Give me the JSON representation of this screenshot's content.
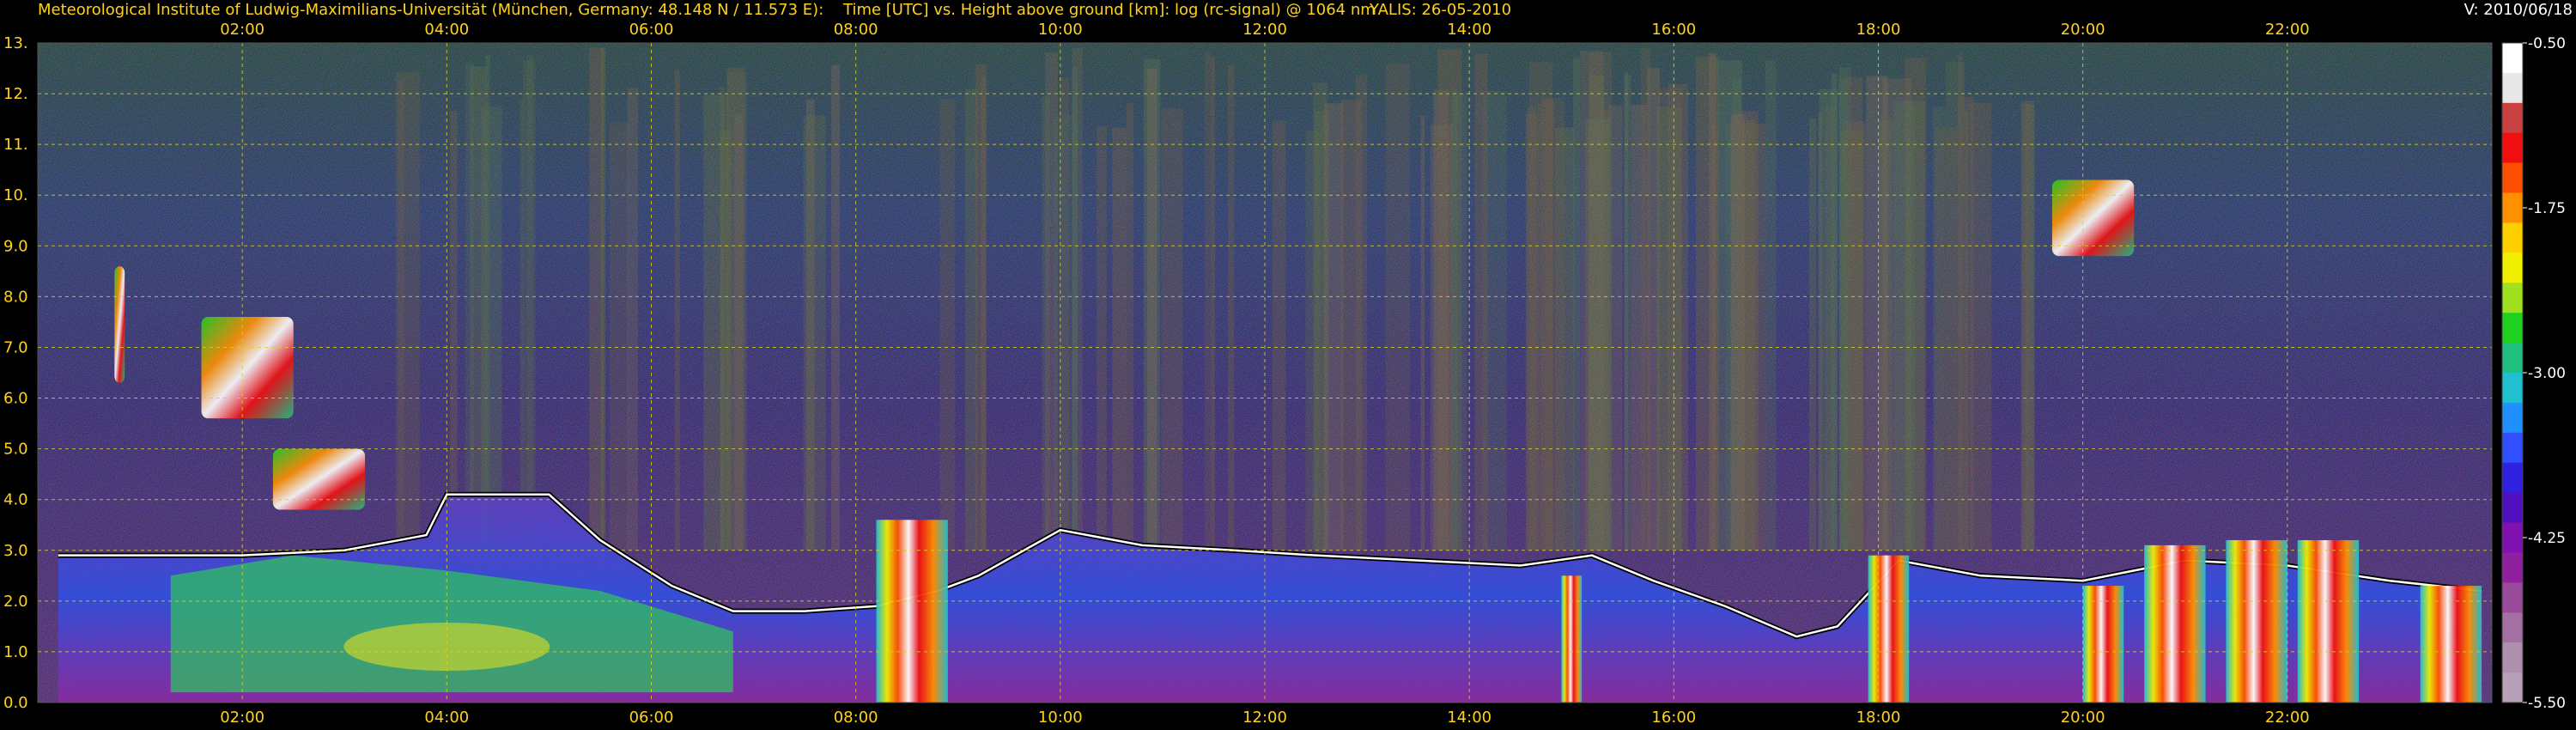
{
  "header": {
    "institute": "Meteorological Institute of Ludwig-Maximilians-Universität (München, Germany: 48.148 N / 11.573 E):",
    "title": "Time [UTC] vs. Height above ground [km]: log (rc-signal) @ 1064 nm",
    "instrument": "YALIS: 26-05-2010",
    "version": "V: 2010/06/18"
  },
  "chart_data": {
    "type": "heatmap",
    "title": "Time [UTC] vs. Height above ground [km]: log (rc-signal) @ 1064 nm",
    "xlabel": "Time [UTC]",
    "ylabel": "Height above ground [km]",
    "x_ticks": [
      "02:00",
      "04:00",
      "06:00",
      "08:00",
      "10:00",
      "12:00",
      "14:00",
      "16:00",
      "18:00",
      "20:00",
      "22:00"
    ],
    "x_tick_hours": [
      2,
      4,
      6,
      8,
      10,
      12,
      14,
      16,
      18,
      20,
      22
    ],
    "xlim_hours": [
      0.0,
      24.0
    ],
    "y_ticks": [
      "0.0",
      "1.0",
      "2.0",
      "3.0",
      "4.0",
      "5.0",
      "6.0",
      "7.0",
      "8.0",
      "9.0",
      "10.",
      "11.",
      "12.",
      "13."
    ],
    "y_tick_values": [
      0,
      1,
      2,
      3,
      4,
      5,
      6,
      7,
      8,
      9,
      10,
      11,
      12,
      13
    ],
    "ylim": [
      0,
      13
    ],
    "grid": true,
    "colorbar": {
      "ticks": [
        "-0.50",
        "-1.75",
        "-3.00",
        "-4.25",
        "-5.50"
      ],
      "tick_values": [
        -0.5,
        -1.75,
        -3.0,
        -4.25,
        -5.5
      ],
      "range": [
        -5.5,
        -0.5
      ]
    },
    "features": {
      "boundary_layer_top_km": [
        [
          0.2,
          2.9
        ],
        [
          1.0,
          2.9
        ],
        [
          2.0,
          2.9
        ],
        [
          3.0,
          3.0
        ],
        [
          3.8,
          3.3
        ],
        [
          4.0,
          4.1
        ],
        [
          5.0,
          4.1
        ],
        [
          5.5,
          3.2
        ],
        [
          6.2,
          2.3
        ],
        [
          6.8,
          1.8
        ],
        [
          7.5,
          1.8
        ],
        [
          8.2,
          1.9
        ],
        [
          8.8,
          2.2
        ],
        [
          9.2,
          2.5
        ],
        [
          10.0,
          3.4
        ],
        [
          10.8,
          3.1
        ],
        [
          11.7,
          3.0
        ],
        [
          12.5,
          2.9
        ],
        [
          13.5,
          2.8
        ],
        [
          14.5,
          2.7
        ],
        [
          15.2,
          2.9
        ],
        [
          15.8,
          2.4
        ],
        [
          16.5,
          1.9
        ],
        [
          17.2,
          1.3
        ],
        [
          17.6,
          1.5
        ],
        [
          18.2,
          2.8
        ],
        [
          19.0,
          2.5
        ],
        [
          20.0,
          2.4
        ],
        [
          21.0,
          2.8
        ],
        [
          22.0,
          2.7
        ],
        [
          23.0,
          2.4
        ],
        [
          23.9,
          2.2
        ]
      ],
      "cirrus_clouds": [
        {
          "t_start": 0.75,
          "t_end": 0.85,
          "z_bottom": 6.3,
          "z_top": 8.6
        },
        {
          "t_start": 1.6,
          "t_end": 2.5,
          "z_bottom": 5.6,
          "z_top": 7.6
        },
        {
          "t_start": 2.3,
          "t_end": 3.2,
          "z_bottom": 3.8,
          "z_top": 5.0
        },
        {
          "t_start": 19.7,
          "t_end": 20.5,
          "z_bottom": 8.8,
          "z_top": 10.3
        }
      ],
      "convective_cells": [
        {
          "t_start": 8.2,
          "t_end": 8.9,
          "z_top": 3.6
        },
        {
          "t_start": 14.9,
          "t_end": 15.1,
          "z_top": 2.5
        },
        {
          "t_start": 17.9,
          "t_end": 18.3,
          "z_top": 2.9
        },
        {
          "t_start": 20.0,
          "t_end": 20.4,
          "z_top": 2.3
        },
        {
          "t_start": 20.6,
          "t_end": 21.2,
          "z_top": 3.1
        },
        {
          "t_start": 21.4,
          "t_end": 22.0,
          "z_top": 3.2
        },
        {
          "t_start": 22.1,
          "t_end": 22.7,
          "z_top": 3.2
        },
        {
          "t_start": 23.3,
          "t_end": 23.9,
          "z_top": 2.3
        }
      ]
    }
  },
  "colors": {
    "header_text": "#ffd21a",
    "version_text": "#ffffff",
    "grid": "#d8d020",
    "background": "#000000",
    "colorbar": [
      "#ffffff",
      "#e8e8e8",
      "#c84040",
      "#f01010",
      "#ff5000",
      "#ff9000",
      "#ffd000",
      "#f0f000",
      "#a0e020",
      "#20d020",
      "#20c080",
      "#20c0d0",
      "#2090ff",
      "#3050ff",
      "#3020e0",
      "#5010c0",
      "#8010b0",
      "#9020a0",
      "#9a4a9a",
      "#a470a4",
      "#b090b0",
      "#b8a0b8"
    ]
  }
}
